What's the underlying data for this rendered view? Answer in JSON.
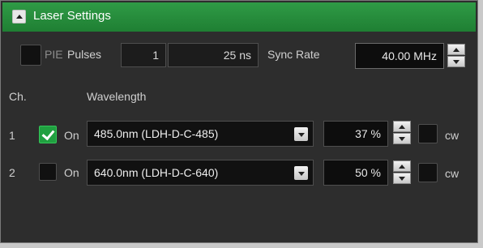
{
  "panel": {
    "title": "Laser Settings"
  },
  "pie": {
    "label": "PIE",
    "checked": false
  },
  "pulses": {
    "label": "Pulses",
    "count": "1",
    "duration": "25 ns"
  },
  "sync_rate": {
    "label": "Sync Rate",
    "value": "40.00 MHz"
  },
  "columns": {
    "channel": "Ch.",
    "wavelength": "Wavelength"
  },
  "channels": [
    {
      "number": "1",
      "enabled": true,
      "on_label": "On",
      "wavelength": "485.0nm (LDH-D-C-485)",
      "power": "37 %",
      "cw_label": "cw"
    },
    {
      "number": "2",
      "enabled": false,
      "on_label": "On",
      "wavelength": "640.0nm (LDH-D-C-640)",
      "power": "50 %",
      "cw_label": "cw"
    }
  ],
  "colors": {
    "header_green": "#1f7f33",
    "panel_bg": "#2d2d2d",
    "check_green": "#20a040"
  }
}
